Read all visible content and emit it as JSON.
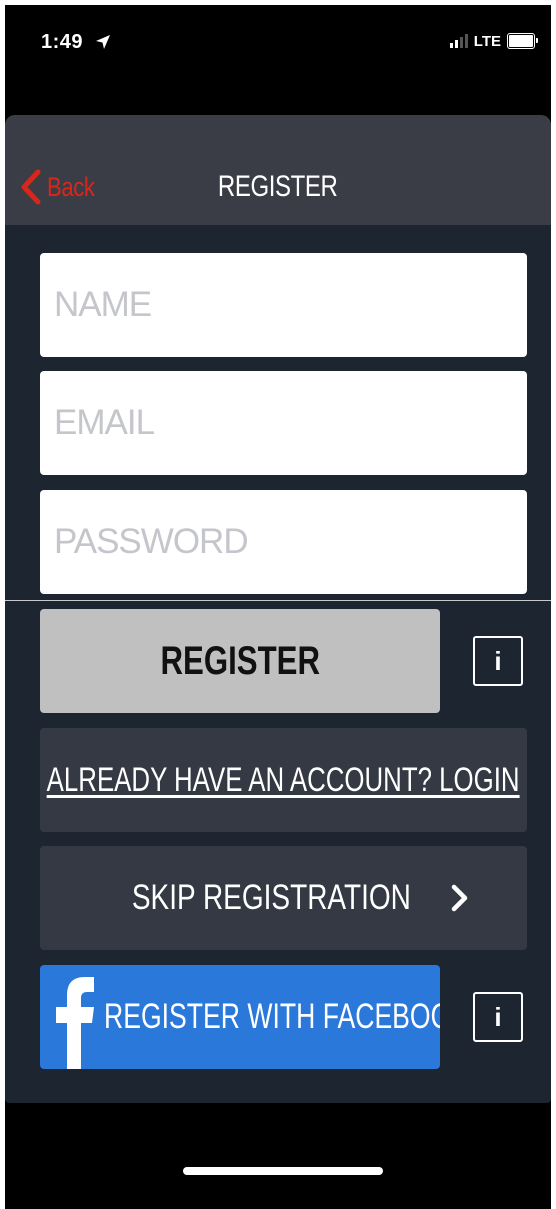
{
  "status_bar": {
    "time": "1:49",
    "network": "LTE"
  },
  "navbar": {
    "back_label": "Back",
    "title": "REGISTER"
  },
  "form": {
    "name_placeholder": "NAME",
    "email_placeholder": "EMAIL",
    "password_placeholder": "PASSWORD"
  },
  "buttons": {
    "register": "REGISTER",
    "login": "ALREADY HAVE AN ACCOUNT? LOGIN",
    "skip": "SKIP REGISTRATION",
    "facebook": "REGISTER WITH FACEBOOK",
    "info": "i"
  },
  "colors": {
    "accent_red": "#d9261c",
    "facebook_blue": "#2a78d9",
    "panel_bg": "#1d2531",
    "navbar_bg": "#3a3d45",
    "secondary_button_bg": "#343944",
    "register_button_bg": "#c0c0c0"
  },
  "icons": {
    "back": "chevron-left-icon",
    "location": "location-arrow-icon",
    "info": "info-icon",
    "skip": "chevron-right-icon",
    "facebook": "facebook-logo-icon"
  }
}
